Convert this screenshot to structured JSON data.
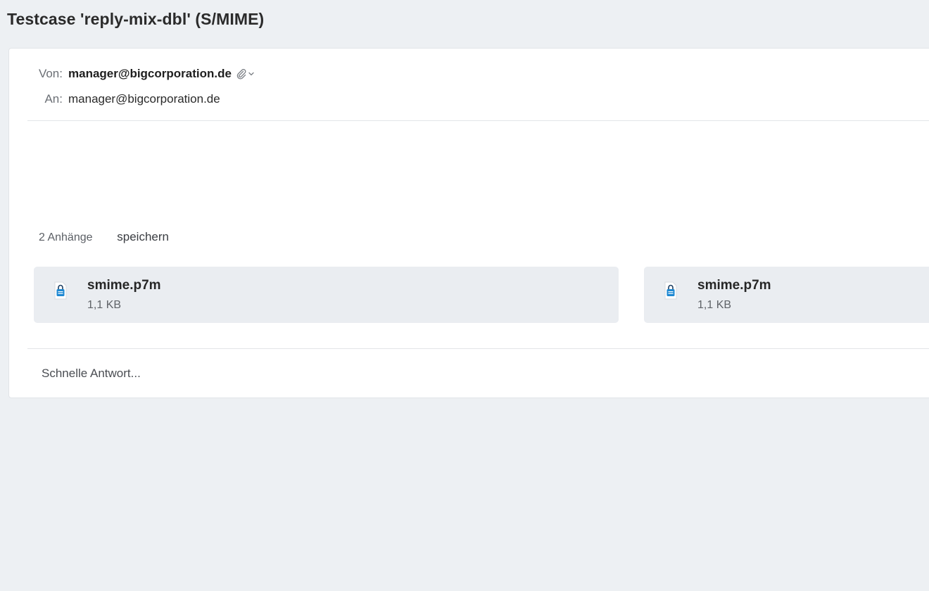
{
  "message": {
    "subject": "Testcase 'reply-mix-dbl' (S/MIME)",
    "from_label": "Von:",
    "from_value": "manager@bigcorporation.de",
    "to_label": "An:",
    "to_value": "manager@bigcorporation.de"
  },
  "attachments": {
    "count_label": "2 Anhänge",
    "save_label": "speichern",
    "items": [
      {
        "name": "smime.p7m",
        "size": "1,1 KB",
        "icon": "encrypted-file-icon"
      },
      {
        "name": "smime.p7m",
        "size": "1,1 KB",
        "icon": "encrypted-file-icon"
      }
    ]
  },
  "reply": {
    "placeholder": "Schnelle Antwort..."
  },
  "colors": {
    "background": "#edf0f3",
    "card": "#ffffff",
    "attachment_bg": "#eaedf1",
    "file_icon_blue": "#1e88d2"
  }
}
